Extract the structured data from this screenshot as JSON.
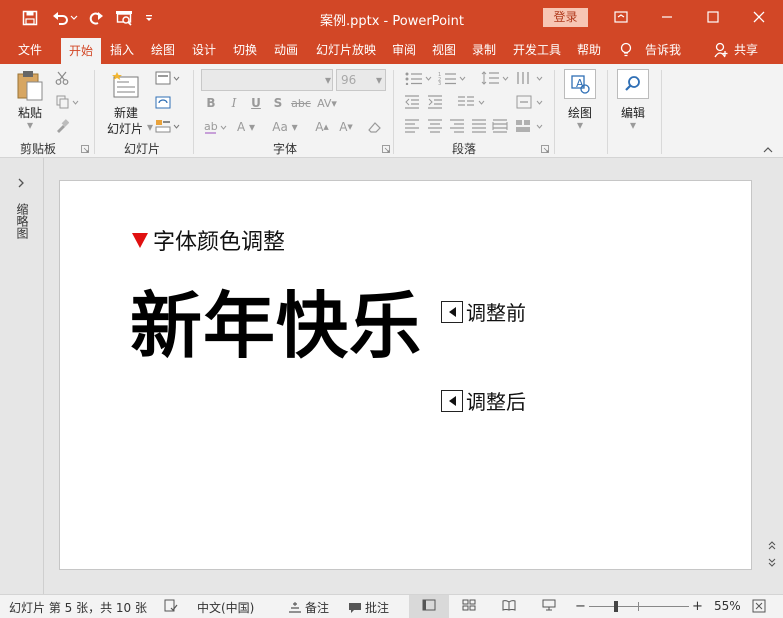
{
  "titlebar": {
    "title": "案例.pptx  -  PowerPoint",
    "login": "登录",
    "quick_access": [
      "save-icon",
      "undo-icon",
      "redo-icon",
      "presenter-icon",
      "customize-icon"
    ],
    "colors": {
      "accent": "#d24726"
    }
  },
  "tabs": [
    {
      "label": "文件"
    },
    {
      "label": "开始"
    },
    {
      "label": "插入"
    },
    {
      "label": "绘图"
    },
    {
      "label": "设计"
    },
    {
      "label": "切换"
    },
    {
      "label": "动画"
    },
    {
      "label": "幻灯片放映"
    },
    {
      "label": "审阅"
    },
    {
      "label": "视图"
    },
    {
      "label": "录制"
    },
    {
      "label": "开发工具"
    },
    {
      "label": "帮助"
    }
  ],
  "tell_me": "告诉我",
  "share": "共享",
  "ribbon": {
    "paste": "粘贴",
    "clipboard_group": "剪贴板",
    "new_slide_line1": "新建",
    "new_slide_line2": "幻灯片",
    "slides_group": "幻灯片",
    "font_name": "",
    "font_size": "96",
    "font_group": "字体",
    "paragraph_group": "段落",
    "drawing": "绘图",
    "editing": "编辑"
  },
  "rail": {
    "label": "缩略图"
  },
  "slide": {
    "heading": "字体颜色调整",
    "title": "新年快乐",
    "before_label": "调整前",
    "after_label": "调整后"
  },
  "status": {
    "slide_info": "幻灯片 第 5 张，共 10 张",
    "language": "中文(中国)",
    "notes": "备注",
    "comments": "批注",
    "zoom": "55%",
    "zoom_level": 0.55
  }
}
